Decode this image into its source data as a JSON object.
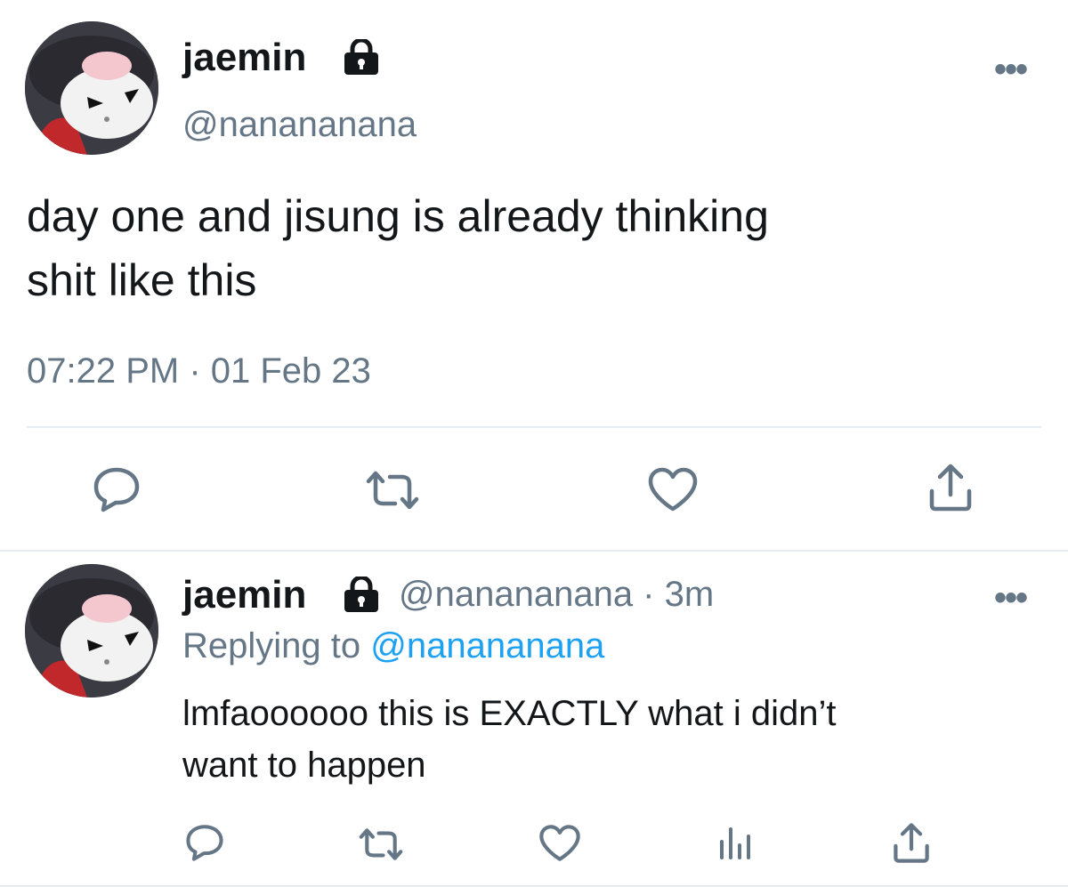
{
  "main_tweet": {
    "display_name": "jaemin",
    "handle": "@nanananana",
    "text_line1": "day one and jisung is already thinking",
    "text_line2": "shit like this",
    "timestamp": "07:22 PM · 01 Feb 23",
    "more": "•••",
    "actions": [
      "reply-icon",
      "retweet-icon",
      "like-icon",
      "share-icon"
    ]
  },
  "reply_tweet": {
    "display_name": "jaemin",
    "handle_time": "@nanananana · 3m",
    "replying_prefix": "Replying to",
    "replying_handle": "@nanananana",
    "text_line1": "lmfaoooooo this is EXACTLY what i didn’t",
    "text_line2": "want to happen",
    "more": "•••",
    "actions": [
      "reply-icon",
      "retweet-icon",
      "like-icon",
      "analytics-icon",
      "share-icon"
    ]
  },
  "colors": {
    "text": "#14171a",
    "secondary": "#657786",
    "link": "#1da1f2",
    "divider": "#e6ecf0"
  }
}
